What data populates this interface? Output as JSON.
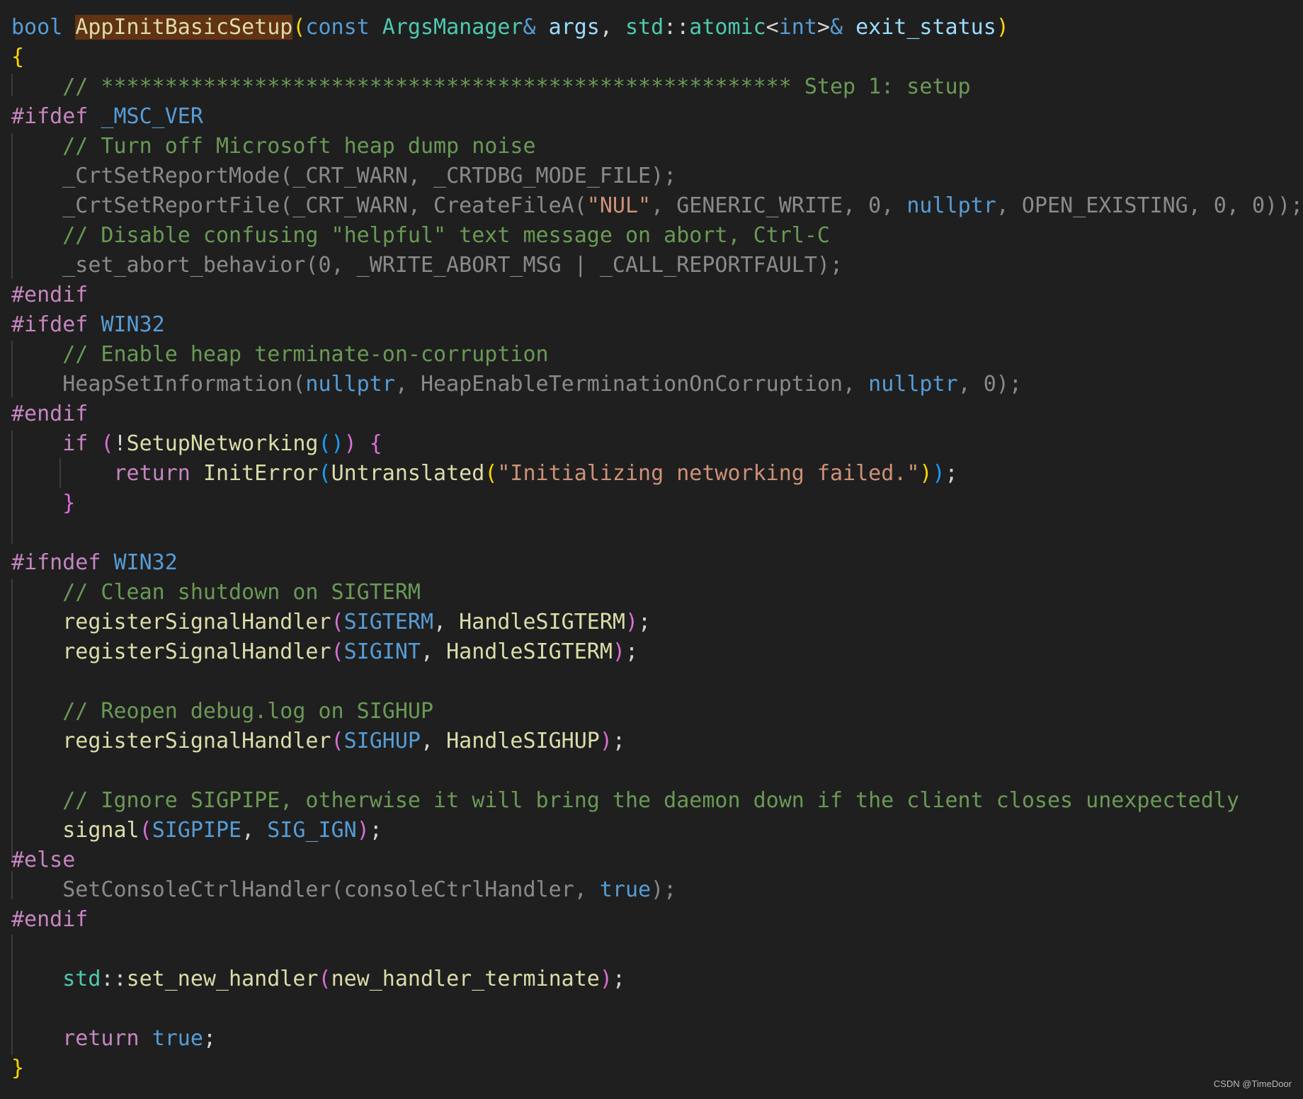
{
  "colors": {
    "background": "#1f1f1f",
    "keyword": "#569cd6",
    "type": "#4ec9b0",
    "function": "#dcdcaa",
    "variable": "#9cdcfe",
    "comment": "#6a9955",
    "string": "#ce9178",
    "number": "#b5cea8",
    "preprocessor": "#c586c0",
    "inactive": "#8a8a8a",
    "bracket_gold": "#ffd700",
    "bracket_pink": "#da70d6",
    "bracket_blue": "#179fff",
    "highlight": "#613214"
  },
  "code": {
    "lines": [
      [
        [
          "bool",
          "kw"
        ],
        [
          " ",
          "plain"
        ],
        [
          "AppInitBasicSetup",
          "fn hl"
        ],
        [
          "(",
          "gold"
        ],
        [
          "const",
          "kw"
        ],
        [
          " ",
          "plain"
        ],
        [
          "ArgsManager",
          "type"
        ],
        [
          "&",
          "kw"
        ],
        [
          " ",
          "plain"
        ],
        [
          "args",
          "var"
        ],
        [
          ", ",
          "plain"
        ],
        [
          "std",
          "type"
        ],
        [
          "::",
          "plain"
        ],
        [
          "atomic",
          "type"
        ],
        [
          "<",
          "plain"
        ],
        [
          "int",
          "kw"
        ],
        [
          ">",
          "plain"
        ],
        [
          "&",
          "kw"
        ],
        [
          " ",
          "plain"
        ],
        [
          "exit_status",
          "var"
        ],
        [
          ")",
          "gold"
        ]
      ],
      [
        [
          "{",
          "gold"
        ]
      ],
      [
        [
          "    // ****************************************************** Step 1: setup",
          "cm"
        ]
      ],
      [
        [
          "#ifdef",
          "pp"
        ],
        [
          " ",
          "plain"
        ],
        [
          "_MSC_VER",
          "macro"
        ]
      ],
      [
        [
          "    // Turn off Microsoft heap dump noise",
          "cm"
        ]
      ],
      [
        [
          "    _CrtSetReportMode(_CRT_WARN, _CRTDBG_MODE_FILE);",
          "dim"
        ]
      ],
      [
        [
          "    _CrtSetReportFile(_CRT_WARN, CreateFileA(",
          "dim"
        ],
        [
          "\"NUL\"",
          "str"
        ],
        [
          ", GENERIC_WRITE, 0, ",
          "dim"
        ],
        [
          "nullptr",
          "kw"
        ],
        [
          ", OPEN_EXISTING, 0, 0));",
          "dim"
        ]
      ],
      [
        [
          "    // Disable confusing \"helpful\" text message on abort, Ctrl-C",
          "cm"
        ]
      ],
      [
        [
          "    _set_abort_behavior(0, _WRITE_ABORT_MSG | _CALL_REPORTFAULT);",
          "dim"
        ]
      ],
      [
        [
          "#endif",
          "pp"
        ]
      ],
      [
        [
          "#ifdef",
          "pp"
        ],
        [
          " ",
          "plain"
        ],
        [
          "WIN32",
          "macro"
        ]
      ],
      [
        [
          "    // Enable heap terminate-on-corruption",
          "cm"
        ]
      ],
      [
        [
          "    HeapSetInformation(",
          "dim"
        ],
        [
          "nullptr",
          "kw"
        ],
        [
          ", HeapEnableTerminationOnCorruption, ",
          "dim"
        ],
        [
          "nullptr",
          "kw"
        ],
        [
          ", 0);",
          "dim"
        ]
      ],
      [
        [
          "#endif",
          "pp"
        ]
      ],
      [
        [
          "    ",
          "plain"
        ],
        [
          "if",
          "pp"
        ],
        [
          " ",
          "plain"
        ],
        [
          "(",
          "pink"
        ],
        [
          "!",
          "plain"
        ],
        [
          "SetupNetworking",
          "fn"
        ],
        [
          "()",
          "blue2"
        ],
        [
          ")",
          "pink"
        ],
        [
          " ",
          "plain"
        ],
        [
          "{",
          "pink"
        ]
      ],
      [
        [
          "        ",
          "plain"
        ],
        [
          "return",
          "pp"
        ],
        [
          " ",
          "plain"
        ],
        [
          "InitError",
          "fn"
        ],
        [
          "(",
          "blue2"
        ],
        [
          "Untranslated",
          "fn"
        ],
        [
          "(",
          "gold"
        ],
        [
          "\"Initializing networking failed.\"",
          "str"
        ],
        [
          ")",
          "gold"
        ],
        [
          ")",
          "blue2"
        ],
        [
          ";",
          "plain"
        ]
      ],
      [
        [
          "    ",
          "plain"
        ],
        [
          "}",
          "pink"
        ]
      ],
      [
        [
          "",
          "plain"
        ]
      ],
      [
        [
          "#ifndef",
          "pp"
        ],
        [
          " ",
          "plain"
        ],
        [
          "WIN32",
          "macro"
        ]
      ],
      [
        [
          "    // Clean shutdown on SIGTERM",
          "cm"
        ]
      ],
      [
        [
          "    ",
          "plain"
        ],
        [
          "registerSignalHandler",
          "fn"
        ],
        [
          "(",
          "pink"
        ],
        [
          "SIGTERM",
          "macro"
        ],
        [
          ", ",
          "plain"
        ],
        [
          "HandleSIGTERM",
          "fn"
        ],
        [
          ")",
          "pink"
        ],
        [
          ";",
          "plain"
        ]
      ],
      [
        [
          "    ",
          "plain"
        ],
        [
          "registerSignalHandler",
          "fn"
        ],
        [
          "(",
          "pink"
        ],
        [
          "SIGINT",
          "macro"
        ],
        [
          ", ",
          "plain"
        ],
        [
          "HandleSIGTERM",
          "fn"
        ],
        [
          ")",
          "pink"
        ],
        [
          ";",
          "plain"
        ]
      ],
      [
        [
          "",
          "plain"
        ]
      ],
      [
        [
          "    // Reopen debug.log on SIGHUP",
          "cm"
        ]
      ],
      [
        [
          "    ",
          "plain"
        ],
        [
          "registerSignalHandler",
          "fn"
        ],
        [
          "(",
          "pink"
        ],
        [
          "SIGHUP",
          "macro"
        ],
        [
          ", ",
          "plain"
        ],
        [
          "HandleSIGHUP",
          "fn"
        ],
        [
          ")",
          "pink"
        ],
        [
          ";",
          "plain"
        ]
      ],
      [
        [
          "",
          "plain"
        ]
      ],
      [
        [
          "    // Ignore SIGPIPE, otherwise it will bring the daemon down if the client closes unexpectedly",
          "cm"
        ]
      ],
      [
        [
          "    ",
          "plain"
        ],
        [
          "signal",
          "fn"
        ],
        [
          "(",
          "pink"
        ],
        [
          "SIGPIPE",
          "macro"
        ],
        [
          ", ",
          "plain"
        ],
        [
          "SIG_IGN",
          "macro"
        ],
        [
          ")",
          "pink"
        ],
        [
          ";",
          "plain"
        ]
      ],
      [
        [
          "#else",
          "pp"
        ]
      ],
      [
        [
          "    SetConsoleCtrlHandler(consoleCtrlHandler, ",
          "dim"
        ],
        [
          "true",
          "kw"
        ],
        [
          ");",
          "dim"
        ]
      ],
      [
        [
          "#endif",
          "pp"
        ]
      ],
      [
        [
          "",
          "plain"
        ]
      ],
      [
        [
          "    ",
          "plain"
        ],
        [
          "std",
          "type"
        ],
        [
          "::",
          "plain"
        ],
        [
          "set_new_handler",
          "fn"
        ],
        [
          "(",
          "pink"
        ],
        [
          "new_handler_terminate",
          "fn"
        ],
        [
          ")",
          "pink"
        ],
        [
          ";",
          "plain"
        ]
      ],
      [
        [
          "",
          "plain"
        ]
      ],
      [
        [
          "    ",
          "plain"
        ],
        [
          "return",
          "pp"
        ],
        [
          " ",
          "plain"
        ],
        [
          "true",
          "kw"
        ],
        [
          ";",
          "plain"
        ]
      ],
      [
        [
          "}",
          "gold"
        ]
      ]
    ]
  },
  "watermark": "CSDN @TimeDoor"
}
